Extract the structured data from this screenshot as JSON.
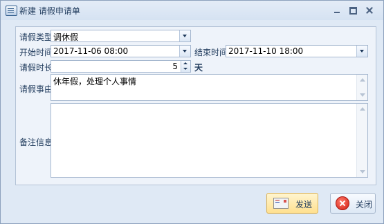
{
  "window": {
    "title": "新建 请假申请单"
  },
  "form": {
    "leave_type_label": "请假类型",
    "leave_type_value": "调休假",
    "start_label": "开始时间",
    "start_value": "2017-11-06 08:00",
    "end_label": "结束时间",
    "end_value": "2017-11-10 18:00",
    "duration_label": "请假时长",
    "duration_value": "5",
    "duration_unit": "天",
    "reason_label": "请假事由",
    "reason_value": "休年假，处理个人事情",
    "notes_label": "备注信息",
    "notes_value": ""
  },
  "buttons": {
    "send_label": "发送",
    "close_label": "关闭"
  },
  "icons": {
    "app": "form-icon",
    "send": "envelope-icon",
    "close": "close-circle-icon"
  }
}
